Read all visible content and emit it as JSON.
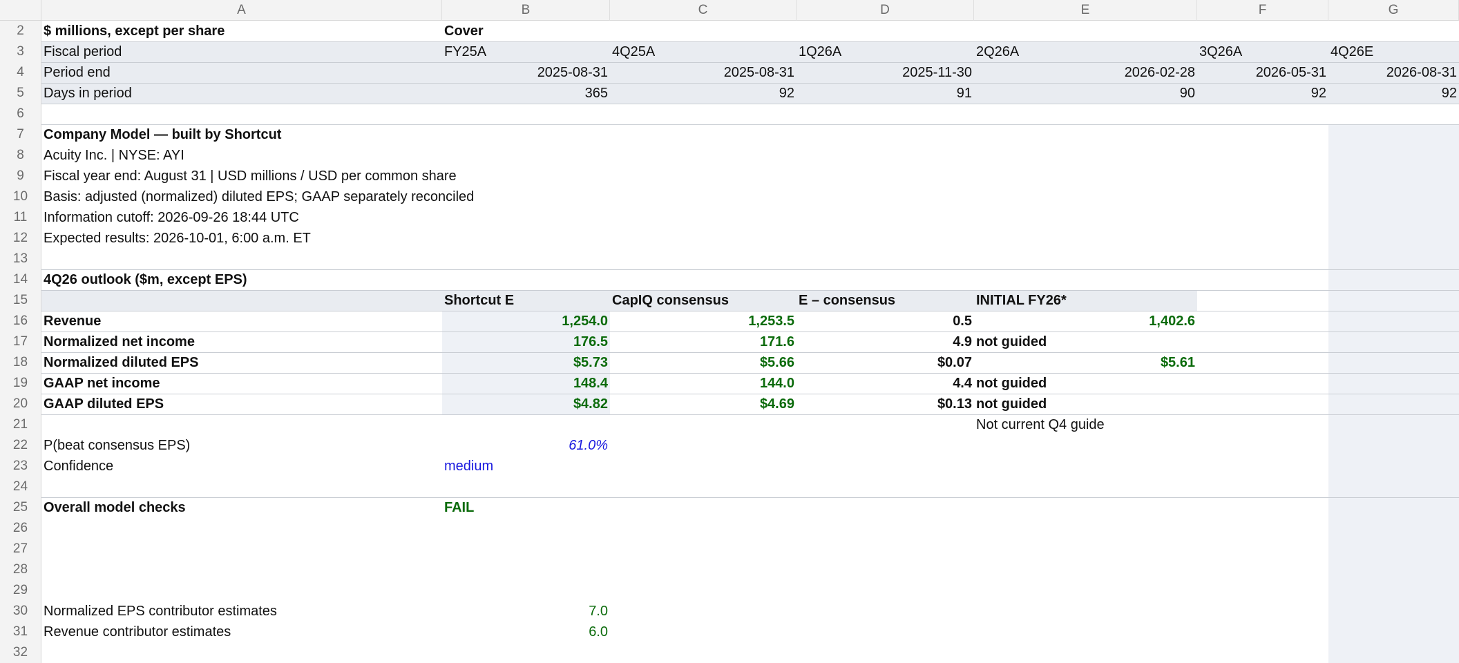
{
  "columns": [
    "A",
    "B",
    "C",
    "D",
    "E",
    "F",
    "G"
  ],
  "row_numbers": [
    "2",
    "3",
    "4",
    "5",
    "6",
    "7",
    "8",
    "9",
    "10",
    "11",
    "12",
    "13",
    "14",
    "15",
    "16",
    "17",
    "18",
    "19",
    "20",
    "21",
    "22",
    "23",
    "24",
    "25",
    "26",
    "27",
    "28",
    "29",
    "30",
    "31",
    "32"
  ],
  "header": {
    "units": "$ millions, except per share",
    "sheet_name": "Cover",
    "fiscal_period_label": "Fiscal period",
    "fiscal_periods": [
      "FY25A",
      "4Q25A",
      "1Q26A",
      "2Q26A",
      "3Q26A",
      "4Q26E"
    ],
    "period_end_label": "Period end",
    "period_ends": [
      "2025-08-31",
      "2025-08-31",
      "2025-11-30",
      "2026-02-28",
      "2026-05-31",
      "2026-08-31"
    ],
    "days_label": "Days in period",
    "days": [
      "365",
      "92",
      "91",
      "90",
      "92",
      "92"
    ]
  },
  "info": {
    "title": "Company Model — built by Shortcut",
    "company": "Acuity Inc. | NYSE: AYI",
    "fiscal_year": "Fiscal year end: August 31 | USD millions / USD per common share",
    "basis": "Basis: adjusted (normalized) diluted EPS; GAAP separately reconciled",
    "cutoff": "Information cutoff: 2026-09-26 18:44 UTC",
    "expected": "Expected results: 2026-10-01, 6:00 a.m. ET"
  },
  "outlook": {
    "title": "4Q26 outlook ($m, except EPS)",
    "col_headers": [
      "Shortcut E",
      "CapIQ consensus",
      "E – consensus",
      "INITIAL FY26*"
    ],
    "rows": [
      {
        "label": "Revenue",
        "shortcut": "1,254.0",
        "consensus": "1,253.5",
        "diff": "0.5",
        "initial": "1,402.6"
      },
      {
        "label": "Normalized net income",
        "shortcut": "176.5",
        "consensus": "171.6",
        "diff": "4.9",
        "initial": "not guided"
      },
      {
        "label": "Normalized diluted EPS",
        "shortcut": "$5.73",
        "consensus": "$5.66",
        "diff": "$0.07",
        "initial": "$5.61"
      },
      {
        "label": "GAAP net income",
        "shortcut": "148.4",
        "consensus": "144.0",
        "diff": "4.4",
        "initial": "not guided"
      },
      {
        "label": "GAAP diluted EPS",
        "shortcut": "$4.82",
        "consensus": "$4.69",
        "diff": "$0.13",
        "initial": "not guided"
      }
    ],
    "footnote": "Not current Q4 guide"
  },
  "probability": {
    "label": "P(beat consensus EPS)",
    "value": "61.0%"
  },
  "confidence": {
    "label": "Confidence",
    "value": "medium"
  },
  "checks": {
    "label": "Overall model checks",
    "value": "FAIL"
  },
  "contributors": [
    {
      "label": "Normalized EPS contributor estimates",
      "value": "7.0"
    },
    {
      "label": "Revenue contributor estimates",
      "value": "6.0"
    }
  ],
  "colors": {
    "header_band": "#e9ecf1",
    "input_fill": "#eef1f6",
    "green": "#0b6b0b",
    "blue": "#1a1adf",
    "g_column": "#eef1f6"
  }
}
